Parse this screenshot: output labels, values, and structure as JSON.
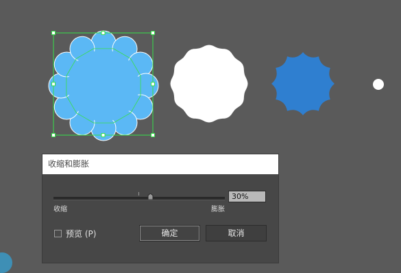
{
  "dialog": {
    "title": "收缩和膨胀",
    "value": "30%",
    "left_label": "收缩",
    "right_label": "膨胀",
    "preview_label": "预览 (P)",
    "ok_label": "确定",
    "cancel_label": "取消",
    "slider_level": 0.58,
    "preview_checked": false
  },
  "artboard": {
    "flower_color": "#5bb8f5",
    "circle_color": "#ffffff",
    "star_color": "#2f7fd0",
    "selection_color": "#37e04a"
  }
}
